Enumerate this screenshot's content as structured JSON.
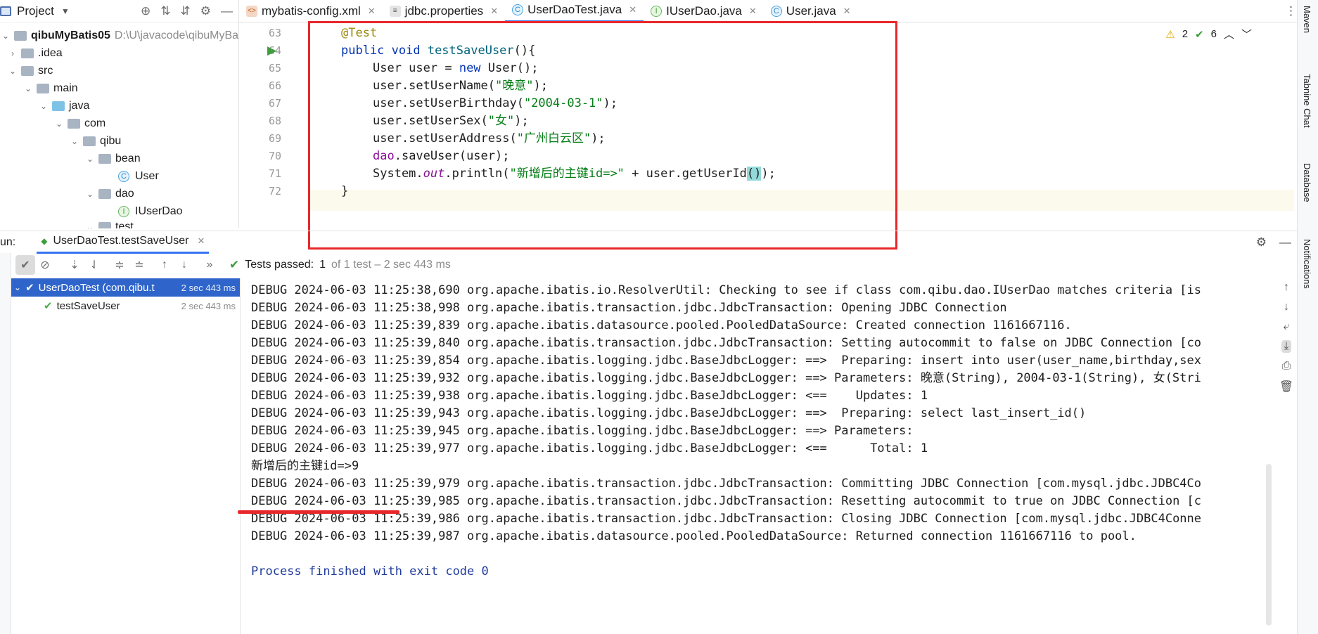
{
  "project": {
    "title": "Project",
    "root_name": "qibuMyBatis05",
    "root_path": "D:\\U\\javacode\\qibuMyBa",
    "items": [
      {
        "label": "qibuMyBatis05"
      },
      {
        "label": ".idea"
      },
      {
        "label": "src"
      },
      {
        "label": "main"
      },
      {
        "label": "java"
      },
      {
        "label": "com"
      },
      {
        "label": "qibu"
      },
      {
        "label": "bean"
      },
      {
        "label": "User"
      },
      {
        "label": "dao"
      },
      {
        "label": "IUserDao"
      },
      {
        "label": "test"
      }
    ]
  },
  "tabs": [
    {
      "label": "mybatis-config.xml"
    },
    {
      "label": "jdbc.properties"
    },
    {
      "label": "UserDaoTest.java"
    },
    {
      "label": "IUserDao.java"
    },
    {
      "label": "User.java"
    }
  ],
  "editor": {
    "warnings": "2",
    "checks": "6",
    "line_numbers": [
      "63",
      "64",
      "65",
      "66",
      "67",
      "68",
      "69",
      "70",
      "71",
      "72"
    ],
    "lines": {
      "l63": "@Test",
      "l64_kw": "public void ",
      "l64_fn": "testSaveUser",
      "l64_end": "(){",
      "l65_a": "User user = ",
      "l65_kw": "new",
      "l65_b": " User();",
      "l66_a": "user.setUserName(",
      "l66_s": "\"晚意\"",
      "l66_b": ");",
      "l67_a": "user.setUserBirthday(",
      "l67_s": "\"2004-03-1\"",
      "l67_b": ");",
      "l68_a": "user.setUserSex(",
      "l68_s": "\"女\"",
      "l68_b": ");",
      "l69_a": "user.setUserAddress(",
      "l69_s": "\"广州白云区\"",
      "l69_b": ");",
      "l70_f": "dao",
      "l70_b": ".saveUser(user);",
      "l71_a": "System.",
      "l71_it": "out",
      "l71_b": ".println(",
      "l71_s": "\"新增后的主键id=>\"",
      "l71_c": " + user.getUserId",
      "l71_hl": "()",
      "l71_d": ");",
      "l72": "}"
    }
  },
  "run": {
    "label": "un:",
    "tab": "UserDaoTest.testSaveUser",
    "passed_prefix": "Tests passed:",
    "passed_count": "1",
    "passed_rest": "of 1 test – 2 sec 443 ms",
    "tree": [
      {
        "label": "UserDaoTest (com.qibu.t",
        "time": "2 sec 443 ms"
      },
      {
        "label": "testSaveUser",
        "time": "2 sec 443 ms"
      }
    ]
  },
  "console": {
    "lines": [
      "DEBUG 2024-06-03 11:25:38,690 org.apache.ibatis.io.ResolverUtil: Checking to see if class com.qibu.dao.IUserDao matches criteria [is",
      "DEBUG 2024-06-03 11:25:38,998 org.apache.ibatis.transaction.jdbc.JdbcTransaction: Opening JDBC Connection",
      "DEBUG 2024-06-03 11:25:39,839 org.apache.ibatis.datasource.pooled.PooledDataSource: Created connection 1161667116.",
      "DEBUG 2024-06-03 11:25:39,840 org.apache.ibatis.transaction.jdbc.JdbcTransaction: Setting autocommit to false on JDBC Connection [co",
      "DEBUG 2024-06-03 11:25:39,854 org.apache.ibatis.logging.jdbc.BaseJdbcLogger: ==>  Preparing: insert into user(user_name,birthday,sex",
      "DEBUG 2024-06-03 11:25:39,932 org.apache.ibatis.logging.jdbc.BaseJdbcLogger: ==> Parameters: 晚意(String), 2004-03-1(String), 女(Stri",
      "DEBUG 2024-06-03 11:25:39,938 org.apache.ibatis.logging.jdbc.BaseJdbcLogger: <==    Updates: 1",
      "DEBUG 2024-06-03 11:25:39,943 org.apache.ibatis.logging.jdbc.BaseJdbcLogger: ==>  Preparing: select last_insert_id()",
      "DEBUG 2024-06-03 11:25:39,945 org.apache.ibatis.logging.jdbc.BaseJdbcLogger: ==> Parameters: ",
      "DEBUG 2024-06-03 11:25:39,977 org.apache.ibatis.logging.jdbc.BaseJdbcLogger: <==      Total: 1",
      "新增后的主键id=>9",
      "DEBUG 2024-06-03 11:25:39,979 org.apache.ibatis.transaction.jdbc.JdbcTransaction: Committing JDBC Connection [com.mysql.jdbc.JDBC4Co",
      "DEBUG 2024-06-03 11:25:39,985 org.apache.ibatis.transaction.jdbc.JdbcTransaction: Resetting autocommit to true on JDBC Connection [c",
      "DEBUG 2024-06-03 11:25:39,986 org.apache.ibatis.transaction.jdbc.JdbcTransaction: Closing JDBC Connection [com.mysql.jdbc.JDBC4Conne",
      "DEBUG 2024-06-03 11:25:39,987 org.apache.ibatis.datasource.pooled.PooledDataSource: Returned connection 1161667116 to pool.",
      "",
      "Process finished with exit code 0"
    ]
  },
  "sidebar_right": {
    "maven": "Maven",
    "tabnine": "Tabnine Chat",
    "database": "Database",
    "notifications": "Notifications"
  },
  "colors": {
    "highlight_box": "#e8272a",
    "selection": "#2f65ca",
    "pass": "#4caf50"
  }
}
